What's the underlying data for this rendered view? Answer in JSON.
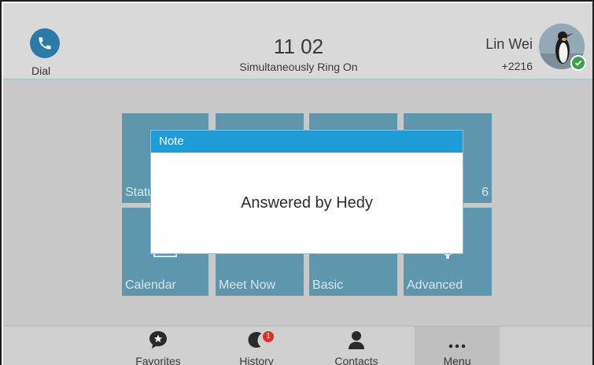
{
  "header": {
    "dial_label": "Dial",
    "clock": "11 02",
    "ring_status": "Simultaneously Ring On",
    "user_name": "Lin Wei",
    "user_ext": "+2216"
  },
  "tiles": {
    "status": "Statu",
    "tile6": "6",
    "calendar": "Calendar",
    "meet_now": "Meet Now",
    "basic": "Basic",
    "advanced": "Advanced"
  },
  "dialog": {
    "title": "Note",
    "message": "Answered by Hedy"
  },
  "softkeys": {
    "favorites": "Favorites",
    "history": "History",
    "history_badge": "1",
    "contacts": "Contacts",
    "menu": "Menu"
  },
  "colors": {
    "tile": "#5d96ad",
    "dialog_title": "#1e9cd8",
    "dial_button": "#2b7ba8",
    "presence": "#39a24a",
    "badge": "#d9302a"
  },
  "icons": {
    "dial": "phone-icon",
    "favorites": "star-speech-icon",
    "history": "history-icon",
    "contacts": "person-icon",
    "menu": "ellipsis-icon",
    "presence": "check-icon"
  }
}
